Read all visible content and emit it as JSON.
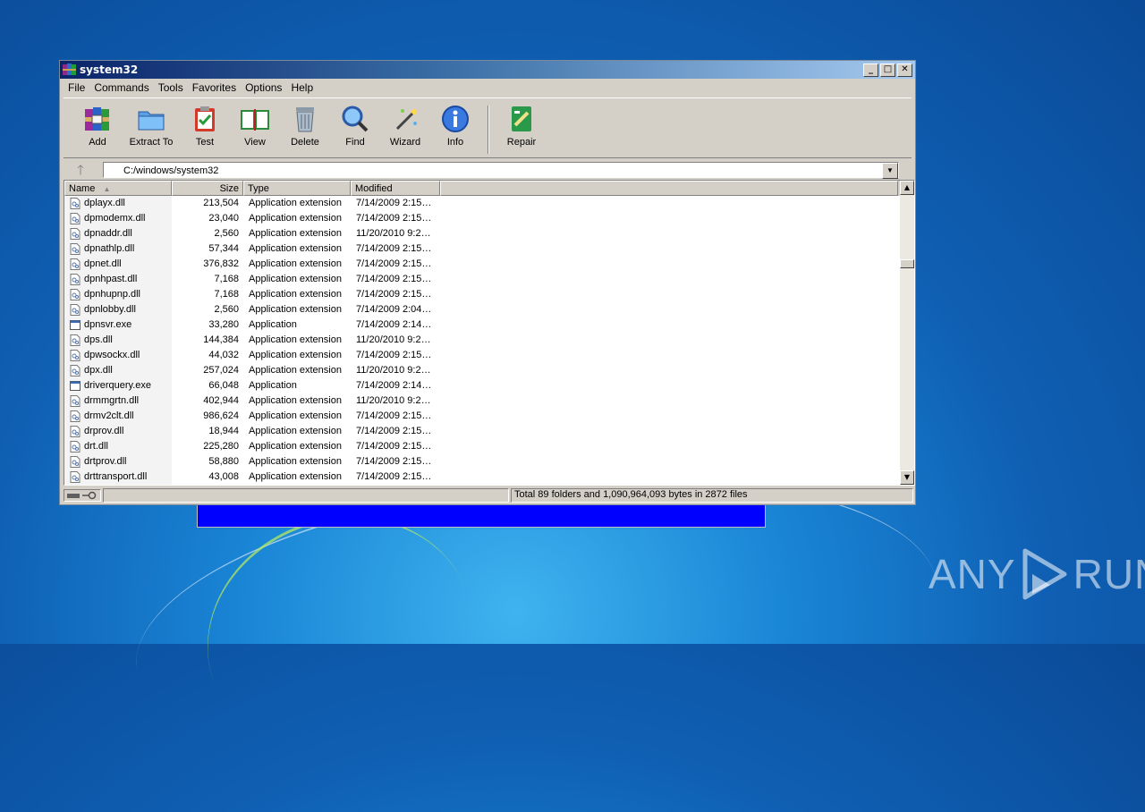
{
  "window": {
    "title": "system32"
  },
  "menu": [
    "File",
    "Commands",
    "Tools",
    "Favorites",
    "Options",
    "Help"
  ],
  "toolbar": [
    {
      "label": "Add",
      "icon": "archive-books-icon"
    },
    {
      "label": "Extract To",
      "icon": "folder-icon"
    },
    {
      "label": "Test",
      "icon": "clipboard-check-icon"
    },
    {
      "label": "View",
      "icon": "open-book-icon"
    },
    {
      "label": "Delete",
      "icon": "trash-icon"
    },
    {
      "label": "Find",
      "icon": "magnifier-icon"
    },
    {
      "label": "Wizard",
      "icon": "magic-wand-icon"
    },
    {
      "label": "Info",
      "icon": "info-icon"
    },
    {
      "label": "Repair",
      "icon": "repair-kit-icon"
    }
  ],
  "address": {
    "path": "C:/windows/system32"
  },
  "columns": {
    "name": "Name",
    "size": "Size",
    "type": "Type",
    "modified": "Modified"
  },
  "files": [
    {
      "name": "dplayx.dll",
      "size": "213,504",
      "type": "Application extension",
      "modified": "7/14/2009 2:15…",
      "kind": "dll"
    },
    {
      "name": "dpmodemx.dll",
      "size": "23,040",
      "type": "Application extension",
      "modified": "7/14/2009 2:15…",
      "kind": "dll"
    },
    {
      "name": "dpnaddr.dll",
      "size": "2,560",
      "type": "Application extension",
      "modified": "11/20/2010 9:2…",
      "kind": "dll"
    },
    {
      "name": "dpnathlp.dll",
      "size": "57,344",
      "type": "Application extension",
      "modified": "7/14/2009 2:15…",
      "kind": "dll"
    },
    {
      "name": "dpnet.dll",
      "size": "376,832",
      "type": "Application extension",
      "modified": "7/14/2009 2:15…",
      "kind": "dll"
    },
    {
      "name": "dpnhpast.dll",
      "size": "7,168",
      "type": "Application extension",
      "modified": "7/14/2009 2:15…",
      "kind": "dll"
    },
    {
      "name": "dpnhupnp.dll",
      "size": "7,168",
      "type": "Application extension",
      "modified": "7/14/2009 2:15…",
      "kind": "dll"
    },
    {
      "name": "dpnlobby.dll",
      "size": "2,560",
      "type": "Application extension",
      "modified": "7/14/2009 2:04…",
      "kind": "dll"
    },
    {
      "name": "dpnsvr.exe",
      "size": "33,280",
      "type": "Application",
      "modified": "7/14/2009 2:14…",
      "kind": "exe"
    },
    {
      "name": "dps.dll",
      "size": "144,384",
      "type": "Application extension",
      "modified": "11/20/2010 9:2…",
      "kind": "dll"
    },
    {
      "name": "dpwsockx.dll",
      "size": "44,032",
      "type": "Application extension",
      "modified": "7/14/2009 2:15…",
      "kind": "dll"
    },
    {
      "name": "dpx.dll",
      "size": "257,024",
      "type": "Application extension",
      "modified": "11/20/2010 9:2…",
      "kind": "dll"
    },
    {
      "name": "driverquery.exe",
      "size": "66,048",
      "type": "Application",
      "modified": "7/14/2009 2:14…",
      "kind": "exe"
    },
    {
      "name": "drmmgrtn.dll",
      "size": "402,944",
      "type": "Application extension",
      "modified": "11/20/2010 9:2…",
      "kind": "dll"
    },
    {
      "name": "drmv2clt.dll",
      "size": "986,624",
      "type": "Application extension",
      "modified": "7/14/2009 2:15…",
      "kind": "dll"
    },
    {
      "name": "drprov.dll",
      "size": "18,944",
      "type": "Application extension",
      "modified": "7/14/2009 2:15…",
      "kind": "dll"
    },
    {
      "name": "drt.dll",
      "size": "225,280",
      "type": "Application extension",
      "modified": "7/14/2009 2:15…",
      "kind": "dll"
    },
    {
      "name": "drtprov.dll",
      "size": "58,880",
      "type": "Application extension",
      "modified": "7/14/2009 2:15…",
      "kind": "dll"
    },
    {
      "name": "drttransport.dll",
      "size": "43,008",
      "type": "Application extension",
      "modified": "7/14/2009 2:15…",
      "kind": "dll"
    }
  ],
  "status": {
    "summary": "Total 89 folders and 1,090,964,093 bytes in 2872 files"
  },
  "watermark": {
    "left": "ANY",
    "right": "RUN"
  }
}
